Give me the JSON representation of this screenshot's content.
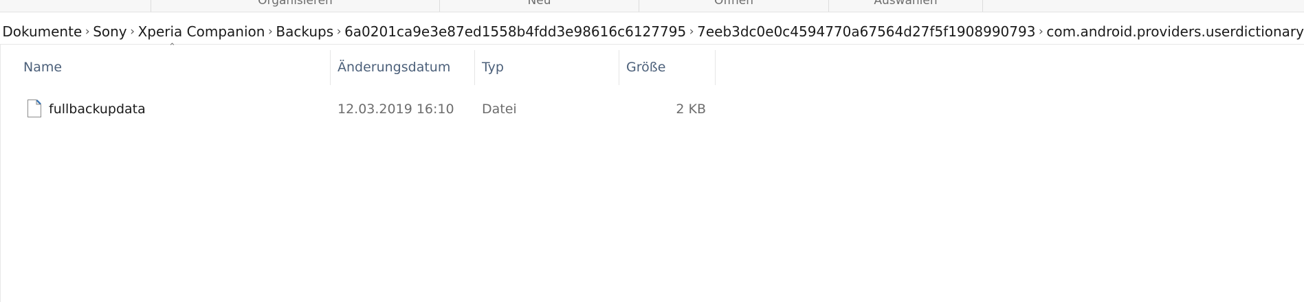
{
  "ribbon": {
    "groups": [
      "Organisieren",
      "Neu",
      "Öffnen",
      "Auswählen"
    ]
  },
  "breadcrumb": {
    "items": [
      "Dokumente",
      "Sony",
      "Xperia Companion",
      "Backups",
      "6a0201ca9e3e87ed1558b4fdd3e98616c6127795",
      "7eeb3dc0e0c4594770a67564d27f5f1908990793",
      "com.android.providers.userdictionary"
    ]
  },
  "columns": {
    "name": "Name",
    "date": "Änderungsdatum",
    "type": "Typ",
    "size": "Größe"
  },
  "files": [
    {
      "name": "fullbackupdata",
      "date": "12.03.2019 16:10",
      "type": "Datei",
      "size": "2 KB",
      "icon": "file-icon"
    }
  ],
  "colors": {
    "header_text": "#4c607a",
    "meta_text": "#6d6d6d"
  }
}
